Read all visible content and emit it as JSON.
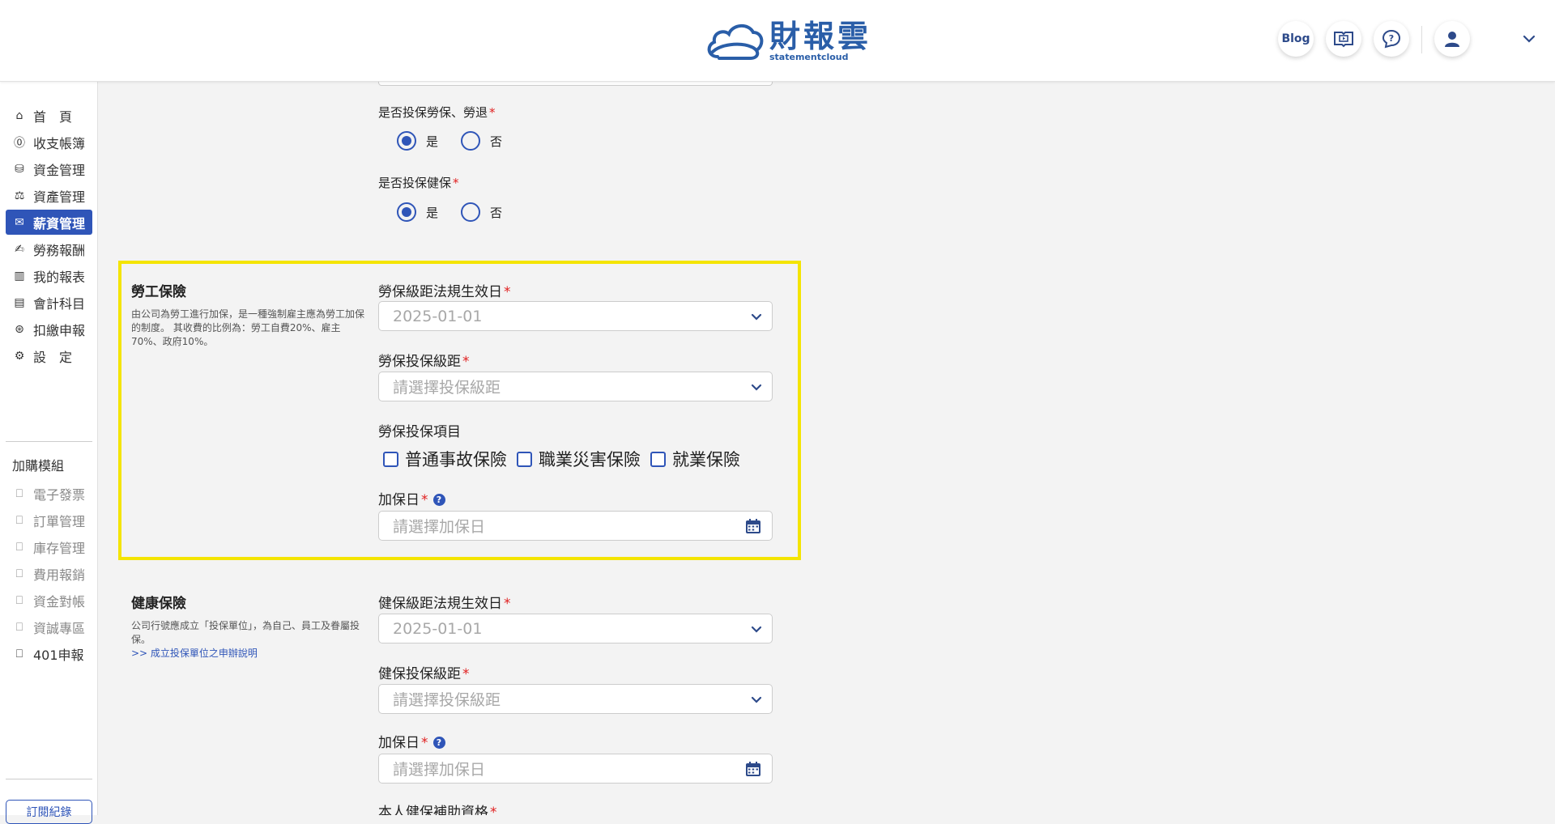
{
  "header": {
    "logo_cn": "財報雲",
    "logo_en": "statementcloud",
    "blog_label": "Blog",
    "colors": {
      "brand": "#2a5ea8",
      "accent": "#2f55b8",
      "highlight": "#f4e400",
      "required": "#e02020"
    }
  },
  "sidebar": {
    "items": [
      {
        "label": "首　頁",
        "icon": "home-icon"
      },
      {
        "label": "收支帳簿",
        "icon": "coin-icon"
      },
      {
        "label": "資金管理",
        "icon": "fund-icon"
      },
      {
        "label": "資產管理",
        "icon": "scale-icon"
      },
      {
        "label": "薪資管理",
        "icon": "salary-icon"
      },
      {
        "label": "勞務報酬",
        "icon": "labor-icon"
      },
      {
        "label": "我的報表",
        "icon": "report-icon"
      },
      {
        "label": "會計科目",
        "icon": "ledger-icon"
      },
      {
        "label": "扣繳申報",
        "icon": "tax-icon"
      },
      {
        "label": "設　定",
        "icon": "settings-icon"
      }
    ],
    "addon_title": "加購模組",
    "addons": [
      {
        "label": "電子發票"
      },
      {
        "label": "訂單管理"
      },
      {
        "label": "庫存管理"
      },
      {
        "label": "費用報銷"
      },
      {
        "label": "資金對帳"
      },
      {
        "label": "資誠專區"
      },
      {
        "label": "401申報"
      }
    ],
    "subscription_label": "訂閱紀錄"
  },
  "form": {
    "labor_pension_q": "是否投保勞保、勞退",
    "health_q": "是否投保健保",
    "yes": "是",
    "no": "否",
    "labor_section": {
      "title": "勞工保險",
      "desc": "由公司為勞工進行加保，是一種強制雇主應為勞工加保的制度。 其收費的比例為：勞工自費20%、雇主70%、政府10%。",
      "effective_label": "勞保級距法規生效日",
      "effective_value": "2025-01-01",
      "grade_label": "勞保投保級距",
      "grade_placeholder": "請選擇投保級距",
      "items_label": "勞保投保項目",
      "items": [
        "普通事故保險",
        "職業災害保險",
        "就業保險"
      ],
      "date_label": "加保日",
      "date_placeholder": "請選擇加保日"
    },
    "health_section": {
      "title": "健康保險",
      "desc": "公司行號應成立「投保單位」，為自己、員工及眷屬投保。",
      "link": ">> 成立投保單位之申辦說明",
      "effective_label": "健保級距法規生效日",
      "effective_value": "2025-01-01",
      "grade_label": "健保投保級距",
      "grade_placeholder": "請選擇投保級距",
      "date_label": "加保日",
      "date_placeholder": "請選擇加保日",
      "subsidy_label": "本人健保補助資格"
    },
    "required_mark": "*",
    "help_mark": "?"
  }
}
